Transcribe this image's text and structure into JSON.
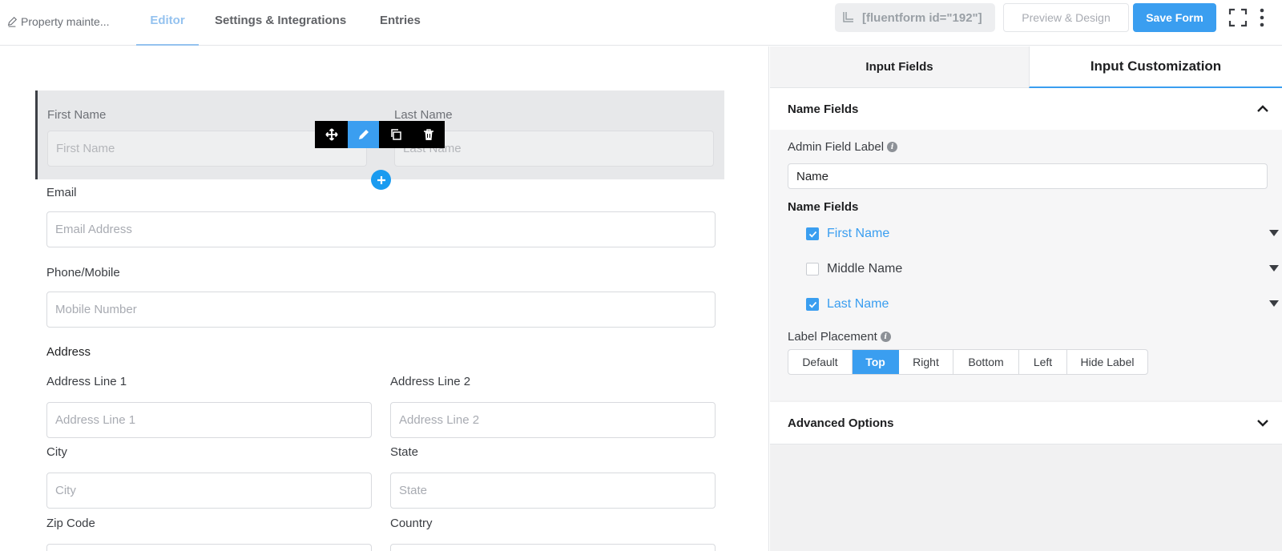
{
  "header": {
    "form_name": "Property mainte...",
    "tabs": [
      {
        "label": "Editor",
        "active": true
      },
      {
        "label": "Settings & Integrations",
        "active": false
      },
      {
        "label": "Entries",
        "active": false
      }
    ],
    "shortcode": "[fluentform id=\"192\"]",
    "preview_label": "Preview & Design",
    "save_label": "Save Form"
  },
  "editor": {
    "name_row": {
      "first_label": "First Name",
      "first_placeholder": "First Name",
      "last_label": "Last Name",
      "last_placeholder": "Last Name"
    },
    "email": {
      "label": "Email",
      "placeholder": "Email Address"
    },
    "phone": {
      "label": "Phone/Mobile",
      "placeholder": "Mobile Number"
    },
    "address": {
      "section_label": "Address",
      "line1": {
        "label": "Address Line 1",
        "placeholder": "Address Line 1"
      },
      "line2": {
        "label": "Address Line 2",
        "placeholder": "Address Line 2"
      },
      "city": {
        "label": "City",
        "placeholder": "City"
      },
      "state": {
        "label": "State",
        "placeholder": "State"
      },
      "zip": {
        "label": "Zip Code"
      },
      "country": {
        "label": "Country"
      }
    },
    "toolbar_icons": [
      "move-icon",
      "pencil-icon",
      "duplicate-icon",
      "trash-icon"
    ]
  },
  "panel": {
    "tabs": [
      {
        "label": "Input Fields",
        "active": false
      },
      {
        "label": "Input Customization",
        "active": true
      }
    ],
    "section_title": "Name Fields",
    "admin_label": "Admin Field Label",
    "admin_value": "Name",
    "name_fields_label": "Name Fields",
    "name_fields": [
      {
        "label": "First Name",
        "checked": true
      },
      {
        "label": "Middle Name",
        "checked": false
      },
      {
        "label": "Last Name",
        "checked": true
      }
    ],
    "label_placement": "Label Placement",
    "placement_options": [
      "Default",
      "Top",
      "Right",
      "Bottom",
      "Left",
      "Hide Label"
    ],
    "placement_selected": "Top",
    "advanced_title": "Advanced Options"
  },
  "colors": {
    "accent": "#3a9ef0",
    "active_tab": "#94c2ef"
  }
}
